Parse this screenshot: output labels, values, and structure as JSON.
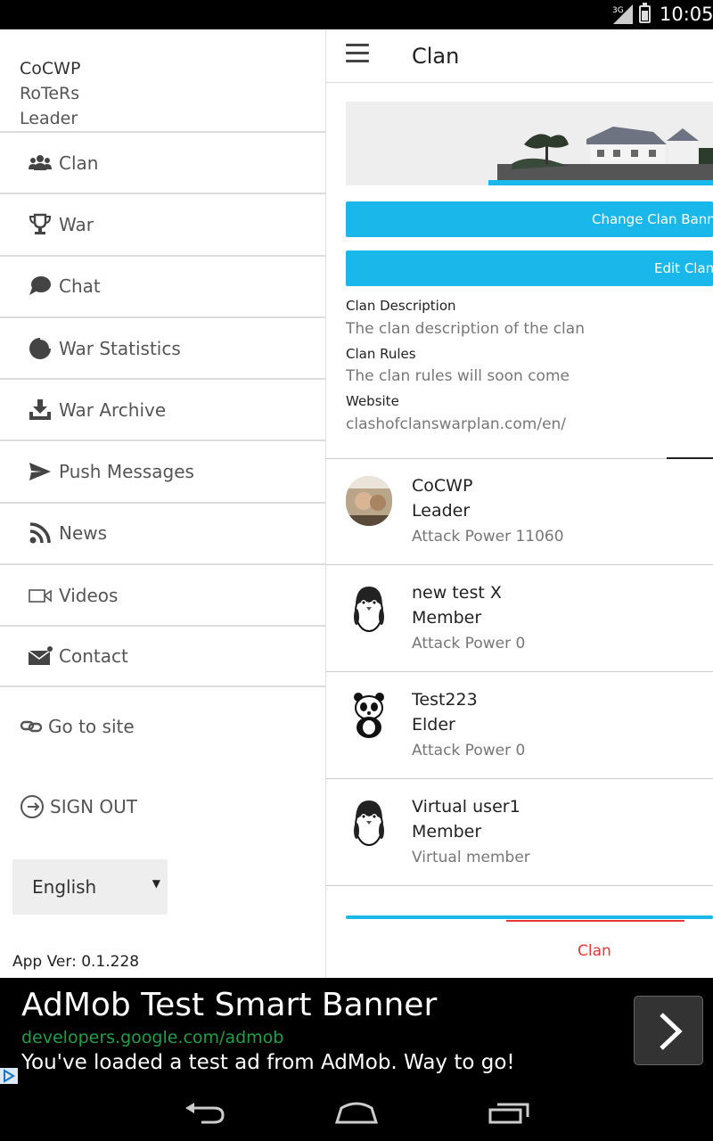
{
  "status_bar": {
    "network": "3G",
    "time": "10:05"
  },
  "drawer": {
    "user_name": "CoCWP",
    "clan_name": "RoTeRs",
    "role": "Leader",
    "menu": [
      {
        "label": "Clan",
        "icon": "users-icon"
      },
      {
        "label": "War",
        "icon": "trophy-icon"
      },
      {
        "label": "Chat",
        "icon": "chat-bubble-icon"
      },
      {
        "label": "War Statistics",
        "icon": "pie-chart-icon"
      },
      {
        "label": "War Archive",
        "icon": "download-icon"
      },
      {
        "label": "Push Messages",
        "icon": "send-icon"
      },
      {
        "label": "News",
        "icon": "rss-icon"
      },
      {
        "label": "Videos",
        "icon": "video-camera-icon"
      },
      {
        "label": "Contact",
        "icon": "mail-icon"
      }
    ],
    "go_to_site": "Go to site",
    "sign_out": "SIGN OUT",
    "language": "English",
    "app_version": "App Ver: 0.1.228"
  },
  "main": {
    "title": "Clan",
    "change_banner_label": "Change Clan Banner",
    "edit_clan_label": "Edit Clan",
    "description_label": "Clan Description",
    "description_value": "The clan description of the clan",
    "rules_label": "Clan Rules",
    "rules_value": "The clan rules will soon come",
    "website_label": "Website",
    "website_value": "clashofclanswarplan.com/en/",
    "members": [
      {
        "name": "CoCWP",
        "role": "Leader",
        "sub": "Attack Power 11060"
      },
      {
        "name": "new test X",
        "role": "Member",
        "sub": "Attack Power 0"
      },
      {
        "name": "Test223",
        "role": "Elder",
        "sub": "Attack Power 0"
      },
      {
        "name": "Virtual user1",
        "role": "Member",
        "sub": "Virtual member"
      }
    ],
    "bottom_tab": "Clan"
  },
  "ad": {
    "title": "AdMob Test Smart Banner",
    "url": "developers.google.com/admob",
    "text": "You've loaded a test ad from AdMob. Way to go!"
  },
  "colors": {
    "accent": "#1ab7ea",
    "tab_active": "#e53935",
    "ad_url": "#1e9e48"
  }
}
